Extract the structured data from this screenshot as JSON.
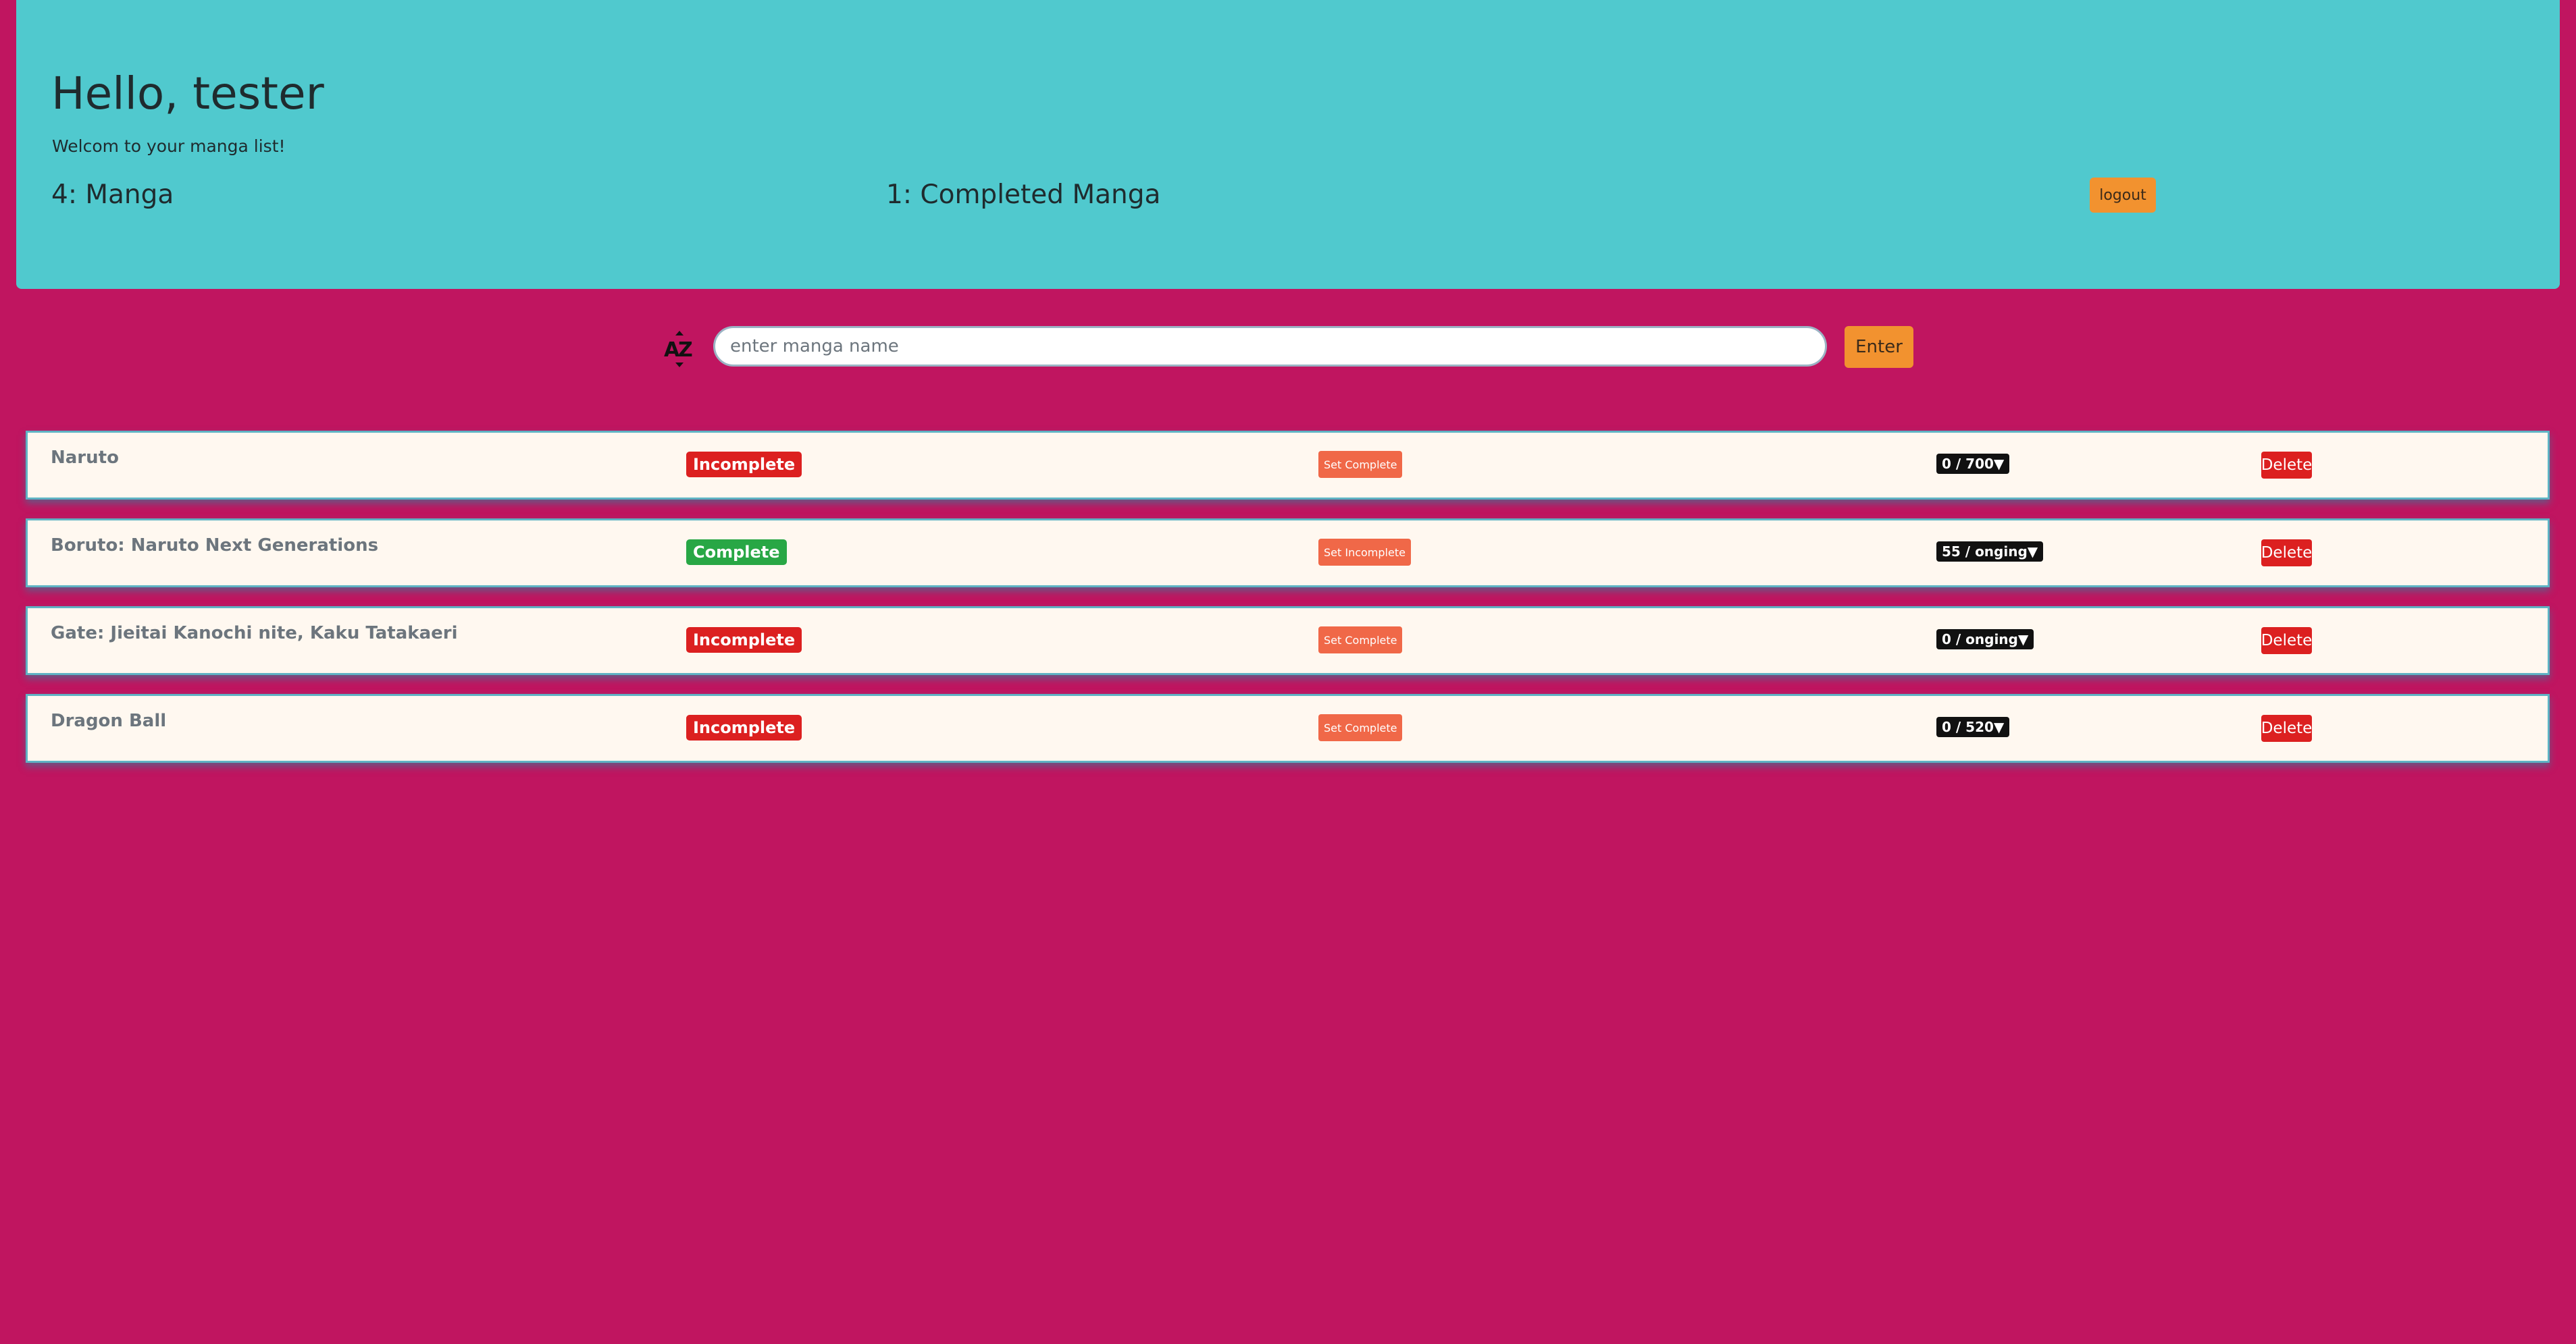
{
  "header": {
    "greeting": "Hello, tester",
    "welcome": "Welcom to your manga list!",
    "manga_count": "4: Manga",
    "completed_count": "1: Completed Manga",
    "logout_label": "logout"
  },
  "search": {
    "sort_icon": "sort-az-icon",
    "placeholder": "enter manga name",
    "value": "",
    "enter_label": "Enter"
  },
  "manga": [
    {
      "title": "Naruto",
      "status": "Incomplete",
      "action": "Set Complete",
      "chapters": "0 / 700▼",
      "delete": "Delete"
    },
    {
      "title": "Boruto: Naruto Next Generations",
      "status": "Complete",
      "action": "Set Incomplete",
      "chapters": "55 / onging▼",
      "delete": "Delete"
    },
    {
      "title": "Gate: Jieitai Kanochi nite, Kaku Tatakaeri",
      "status": "Incomplete",
      "action": "Set Complete",
      "chapters": "0 / onging▼",
      "delete": "Delete"
    },
    {
      "title": "Dragon Ball",
      "status": "Incomplete",
      "action": "Set Complete",
      "chapters": "0 / 520▼",
      "delete": "Delete"
    }
  ],
  "colors": {
    "background": "#c01560",
    "header": "#50c9ce",
    "accent_orange": "#f2922f",
    "danger": "#dc2020",
    "success": "#28a745",
    "set_button": "#f06848"
  }
}
